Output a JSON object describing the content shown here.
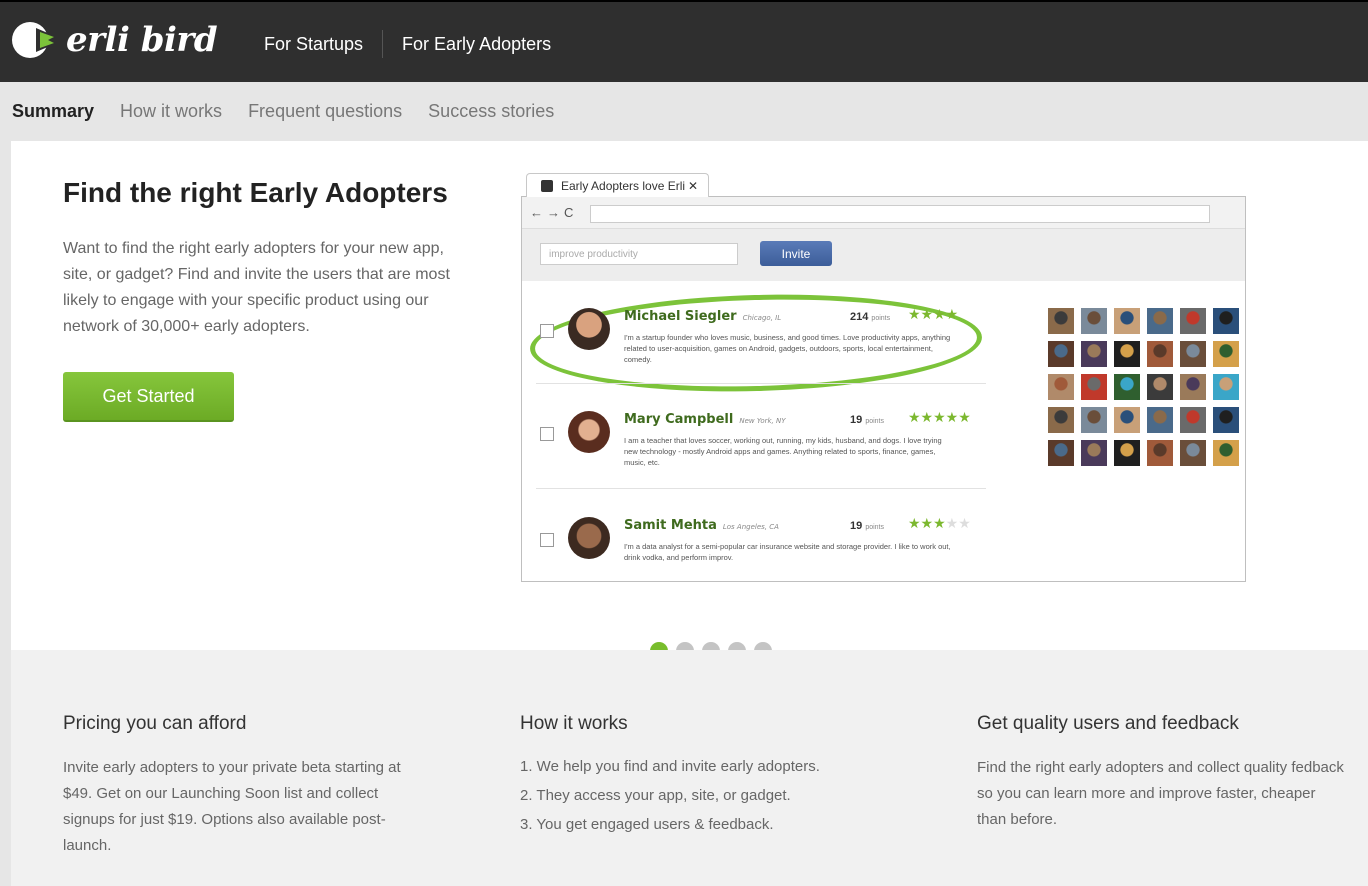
{
  "logo": {
    "text": "erli bird"
  },
  "topnav": {
    "items": [
      "For Startups",
      "For Early Adopters"
    ]
  },
  "subnav": {
    "items": [
      "Summary",
      "How it works",
      "Frequent questions",
      "Success stories"
    ],
    "active": "Summary"
  },
  "hero": {
    "title": "Find the right Early Adopters",
    "text": "Want to find the right early adopters for your new app, site, or gadget? Find and invite the users that are most likely to engage with your specific product using our network of 30,000+ early adopters.",
    "cta": "Get Started"
  },
  "browser": {
    "tab_title": "Early Adopters love Erli",
    "tab_close": "✕",
    "search_placeholder": "improve productivity",
    "invite_label": "Invite",
    "users": [
      {
        "name": "Michael Siegler",
        "location": "Chicago, IL",
        "points": "214",
        "points_label": "points",
        "stars": 4,
        "bio": "I'm a startup founder who loves music, business, and good times. Love productivity apps, anything related to user-acquisition, games on Android, gadgets, outdoors, sports, local entertainment, comedy."
      },
      {
        "name": "Mary Campbell",
        "location": "New York, NY",
        "points": "19",
        "points_label": "points",
        "stars": 5,
        "bio": "I am a teacher that loves soccer, working out, running, my kids, husband, and dogs. I love trying new technology - mostly Android apps and games. Anything related to sports, finance, games, music, etc."
      },
      {
        "name": "Samit Mehta",
        "location": "Los Angeles, CA",
        "points": "19",
        "points_label": "points",
        "stars": 3,
        "bio": "I'm a data analyst for a semi-popular car insurance website and storage provider. I like to work out, drink vodka, and perform improv."
      }
    ]
  },
  "carousel": {
    "count": 5,
    "active": 0
  },
  "columns": [
    {
      "title": "Pricing you can afford",
      "text": "Invite early adopters to your private beta starting at $49. Get on our Launching Soon list and collect signups for just $19. Options also available post-launch."
    },
    {
      "title": "How it works",
      "steps": [
        "1. We help you find and invite early adopters.",
        "2. They access your app, site, or gadget.",
        "3. You get engaged users & feedback."
      ]
    },
    {
      "title": "Get quality users and feedback",
      "text": "Find the right early adopters and collect quality fedback so you can learn more and improve faster, cheaper than before."
    }
  ],
  "colors": {
    "topbar": "#2f2f2f",
    "accent_green": "#78bd2c",
    "invite_blue": "#3c5d99"
  }
}
